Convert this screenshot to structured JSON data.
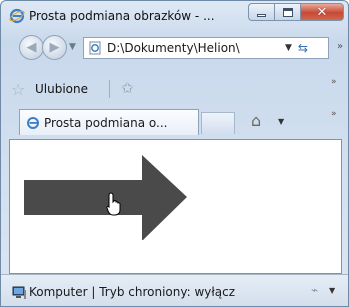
{
  "window": {
    "title": "Prosta podmiana obrazków - ...",
    "min_icon": "minimize-icon",
    "max_icon": "maximize-icon",
    "close_icon": "close-icon"
  },
  "nav": {
    "back_icon": "back-arrow-icon",
    "forward_icon": "forward-arrow-icon",
    "address": "D:\\Dokumenty\\Helion\\",
    "refresh_icon": "refresh-icon",
    "more": "»"
  },
  "favorites": {
    "label": "Ulubione",
    "star_icon": "favorites-star-icon",
    "add_icon": "add-favorite-icon",
    "more": "»"
  },
  "tabs": {
    "active_label": "Prosta podmiana o...",
    "home_icon": "home-icon",
    "more": "»"
  },
  "content": {
    "shape": "right-arrow",
    "arrow_color": "#4a4a4a",
    "cursor": "hand-pointer-cursor"
  },
  "status": {
    "text": "Komputer | Tryb chroniony: wyłącz",
    "zone_icon": "computer-zone-icon"
  },
  "colors": {
    "chrome": "#c9d9ec",
    "close_button": "#c74a35",
    "link_blue": "#3a6fb0"
  }
}
